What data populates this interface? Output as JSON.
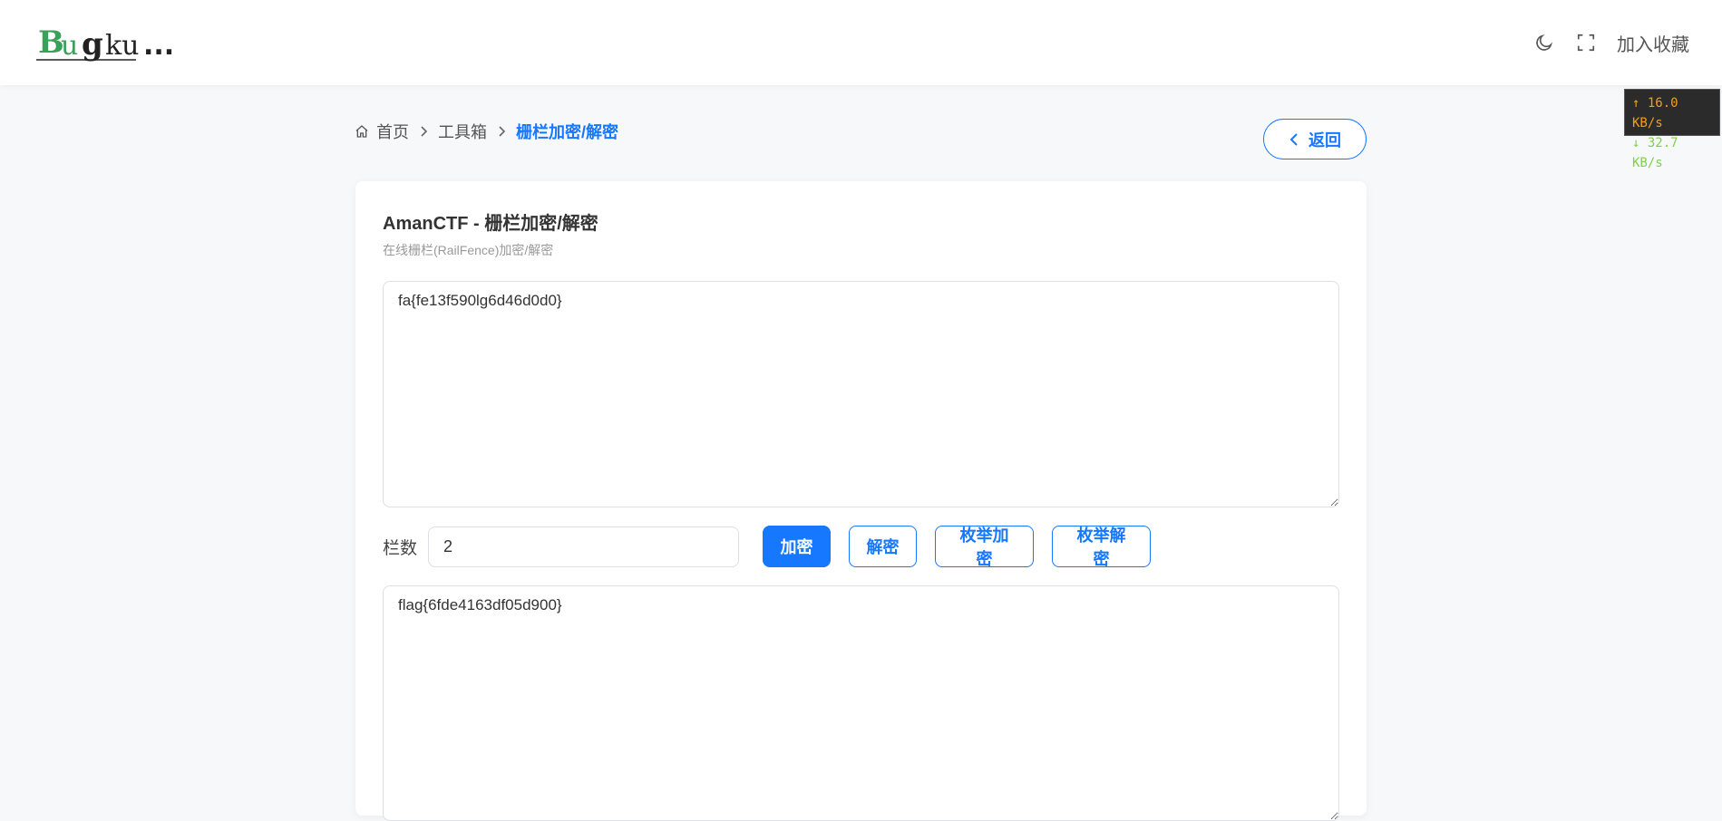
{
  "header": {
    "logo_text": "Bugku...",
    "fav_label": "加入收藏",
    "icons": [
      "moon-icon",
      "fullscreen-icon"
    ]
  },
  "speed": {
    "up": "↑ 16.0 KB/s",
    "down": "↓ 32.7 KB/s"
  },
  "breadcrumb": {
    "home": "首页",
    "toolbox": "工具箱",
    "current": "栅栏加密/解密"
  },
  "back_label": "返回",
  "card": {
    "title": "AmanCTF - 栅栏加密/解密",
    "subtitle": "在线栅栏(RailFence)加密/解密",
    "input_value": "fa{fe13f590lg6d46d0d0}",
    "rail_label": "栏数",
    "rail_value": "2",
    "buttons": {
      "encrypt": "加密",
      "decrypt": "解密",
      "enum_encrypt": "枚举加密",
      "enum_decrypt": "枚举解密"
    },
    "output_value": "flag{6fde4163df05d900}"
  },
  "colors": {
    "accent": "#1677ff",
    "logo_green": "#3aa05a",
    "speed_up": "#f0a020",
    "speed_down": "#7fd14a"
  }
}
